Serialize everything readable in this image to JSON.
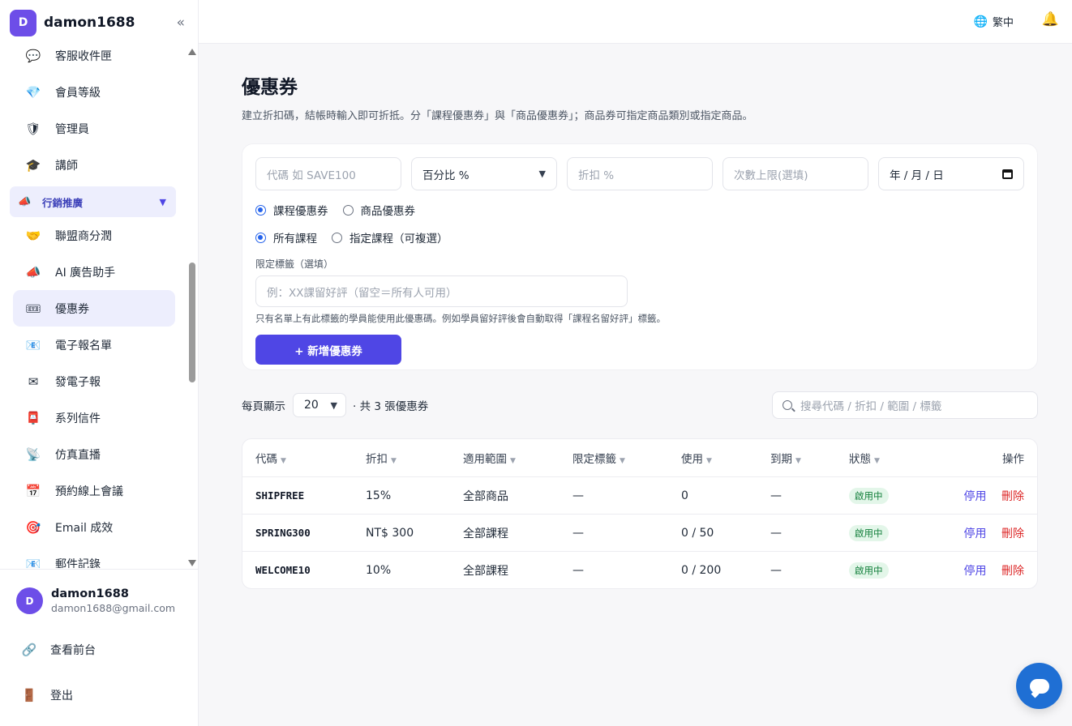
{
  "sidebar": {
    "brand_initial": "D",
    "brand_name": "damon1688",
    "collapse_glyph": "«",
    "items_top": [
      {
        "label": "客服收件匣",
        "icon": "💬"
      },
      {
        "label": "會員等級",
        "icon": "💎"
      },
      {
        "label": "管理員",
        "icon": "🛡"
      },
      {
        "label": "講師",
        "icon": "🎓"
      }
    ],
    "group": {
      "label": "行銷推廣",
      "icon": "📣",
      "caret": "▼"
    },
    "items_group": [
      {
        "label": "聯盟商分潤",
        "icon": "🤝"
      },
      {
        "label": "AI 廣告助手",
        "icon": "📣"
      },
      {
        "label": "優惠券",
        "icon": "🎟"
      },
      {
        "label": "電子報名單",
        "icon": "📧"
      },
      {
        "label": "發電子報",
        "icon": "✉"
      },
      {
        "label": "系列信件",
        "icon": "📮"
      },
      {
        "label": "仿真直播",
        "icon": "📡"
      },
      {
        "label": "預約線上會議",
        "icon": "📅"
      },
      {
        "label": "Email 成效",
        "icon": "🎯"
      },
      {
        "label": "郵件記錄",
        "icon": "📧"
      }
    ],
    "user": {
      "initial": "D",
      "name": "damon1688",
      "email": "damon1688@gmail.com"
    },
    "view_frontend": "查看前台",
    "logout": "登出"
  },
  "topbar": {
    "lang": "繁中",
    "globe_icon": "🌐",
    "bell_icon": "🔔"
  },
  "page": {
    "title": "優惠券",
    "description": "建立折扣碼，結帳時輸入即可折抵。分「課程優惠券」與「商品優惠券」；商品券可指定商品類別或指定商品。"
  },
  "form": {
    "code_placeholder": "代碼 如 SAVE100",
    "type_selected": "百分比 %",
    "discount_placeholder": "折扣 %",
    "limit_placeholder": "次數上限(選填)",
    "date_placeholder": "年 / 月 / 日",
    "radio_course": "課程優惠券",
    "radio_product": "商品優惠券",
    "radio_all_courses": "所有課程",
    "radio_specific_courses": "指定課程（可複選）",
    "tag_label": "限定標籤（選填）",
    "tag_placeholder": "例：XX課留好評（留空＝所有人可用）",
    "tag_hint": "只有名單上有此標籤的學員能使用此優惠碼。例如學員留好評後會自動取得「課程名留好評」標籤。",
    "add_button": "+ 新增優惠券"
  },
  "list": {
    "per_page_label": "每頁顯示",
    "per_page_value": "20",
    "total_text": "· 共 3 張優惠券",
    "search_placeholder": "搜尋代碼 / 折扣 / 範圍 / 標籤",
    "columns": [
      "代碼",
      "折扣",
      "適用範圍",
      "限定標籤",
      "使用",
      "到期",
      "狀態",
      "操作"
    ],
    "sort_glyph": "▼",
    "rows": [
      {
        "code": "SHIPFREE",
        "discount": "15%",
        "scope": "全部商品",
        "tag": "—",
        "usage": "0",
        "expiry": "—",
        "status": "啟用中",
        "disable": "停用",
        "delete": "刪除"
      },
      {
        "code": "SPRING300",
        "discount": "NT$ 300",
        "scope": "全部課程",
        "tag": "—",
        "usage": "0 / 50",
        "expiry": "—",
        "status": "啟用中",
        "disable": "停用",
        "delete": "刪除"
      },
      {
        "code": "WELCOME10",
        "discount": "10%",
        "scope": "全部課程",
        "tag": "—",
        "usage": "0 / 200",
        "expiry": "—",
        "status": "啟用中",
        "disable": "停用",
        "delete": "刪除"
      }
    ]
  },
  "colors": {
    "accent": "#4f46e5",
    "brand": "#6d4ee8",
    "active_bg": "#edeefd",
    "danger": "#dc2626",
    "success": "#15803d"
  }
}
